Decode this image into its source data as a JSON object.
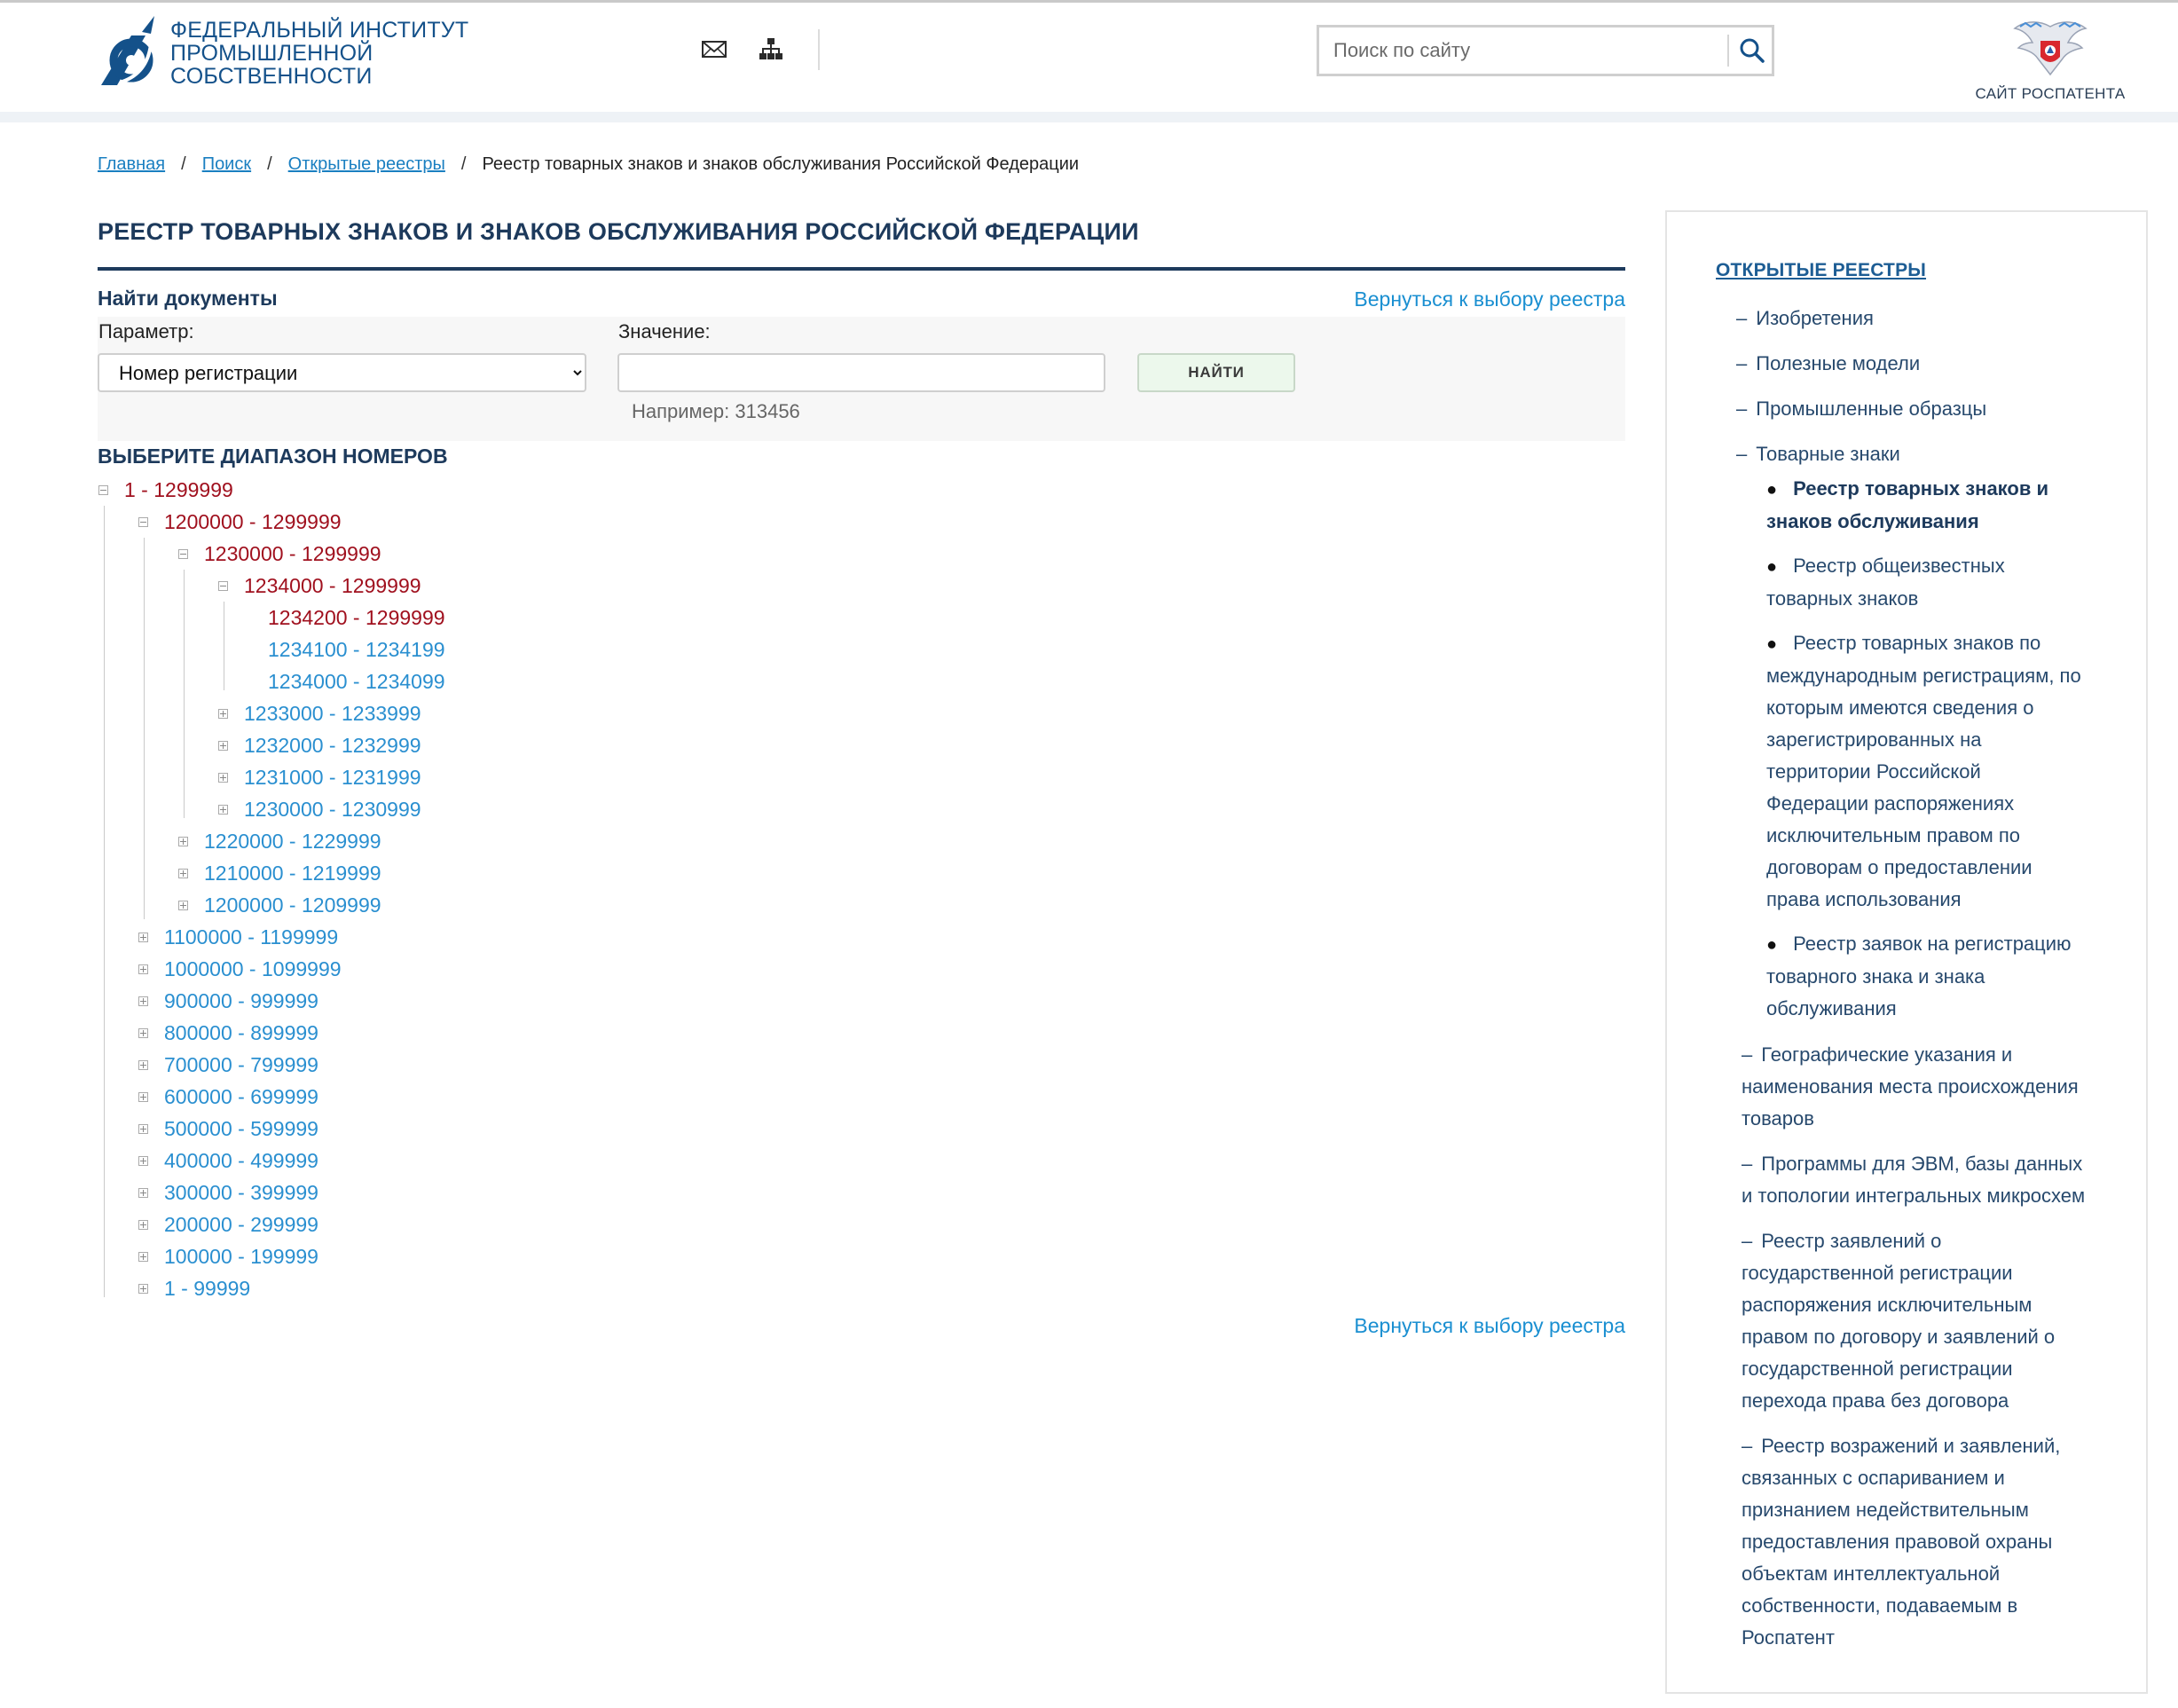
{
  "header": {
    "logo_lines": [
      "ФЕДЕРАЛЬНЫЙ ИНСТИТУТ",
      "ПРОМЫШЛЕННОЙ",
      "СОБСТВЕННОСТИ"
    ],
    "search_placeholder": "Поиск по сайту",
    "rospatent_label": "САЙТ РОСПАТЕНТА",
    "icons": [
      "mail-icon",
      "sitemap-icon",
      "search-icon",
      "rospatent-emblem"
    ],
    "colors": {
      "brand": "#14518a",
      "title": "#1d3a5c",
      "link": "#1a8fd1",
      "tree_open": "#a0101e"
    }
  },
  "breadcrumb": {
    "items": [
      "Главная",
      "Поиск",
      "Открытые реестры"
    ],
    "current": "Реестр товарных знаков и знаков обслуживания Российской Федерации"
  },
  "main": {
    "title": "РЕЕСТР ТОВАРНЫХ ЗНАКОВ И ЗНАКОВ ОБСЛУЖИВАНИЯ РОССИЙСКОЙ ФЕДЕРАЦИИ",
    "find_documents": "Найти документы",
    "back_link": "Вернуться к выбору реестра",
    "param_label": "Параметр:",
    "param_value": "Номер регистрации",
    "value_label": "Значение:",
    "value_input": "",
    "find_button": "НАЙТИ",
    "example": "Например: 313456",
    "range_title": "ВЫБЕРИТЕ ДИАПАЗОН НОМЕРОВ"
  },
  "tree": [
    {
      "label": "1 - 1299999",
      "level": 0,
      "state": "open"
    },
    {
      "label": "1200000 - 1299999",
      "level": 1,
      "state": "open"
    },
    {
      "label": "1230000 - 1299999",
      "level": 2,
      "state": "open"
    },
    {
      "label": "1234000 - 1299999",
      "level": 3,
      "state": "open"
    },
    {
      "label": "1234200 - 1299999",
      "level": 4,
      "state": "leaf-open"
    },
    {
      "label": "1234100 - 1234199",
      "level": 4,
      "state": "leaf"
    },
    {
      "label": "1234000 - 1234099",
      "level": 4,
      "state": "leaf"
    },
    {
      "label": "1233000 - 1233999",
      "level": 3,
      "state": "closed"
    },
    {
      "label": "1232000 - 1232999",
      "level": 3,
      "state": "closed"
    },
    {
      "label": "1231000 - 1231999",
      "level": 3,
      "state": "closed"
    },
    {
      "label": "1230000 - 1230999",
      "level": 3,
      "state": "closed"
    },
    {
      "label": "1220000 - 1229999",
      "level": 2,
      "state": "closed"
    },
    {
      "label": "1210000 - 1219999",
      "level": 2,
      "state": "closed"
    },
    {
      "label": "1200000 - 1209999",
      "level": 2,
      "state": "closed"
    },
    {
      "label": "1100000 - 1199999",
      "level": 1,
      "state": "closed"
    },
    {
      "label": "1000000 - 1099999",
      "level": 1,
      "state": "closed"
    },
    {
      "label": "900000 - 999999",
      "level": 1,
      "state": "closed"
    },
    {
      "label": "800000 - 899999",
      "level": 1,
      "state": "closed"
    },
    {
      "label": "700000 - 799999",
      "level": 1,
      "state": "closed"
    },
    {
      "label": "600000 - 699999",
      "level": 1,
      "state": "closed"
    },
    {
      "label": "500000 - 599999",
      "level": 1,
      "state": "closed"
    },
    {
      "label": "400000 - 499999",
      "level": 1,
      "state": "closed"
    },
    {
      "label": "300000 - 399999",
      "level": 1,
      "state": "closed"
    },
    {
      "label": "200000 - 299999",
      "level": 1,
      "state": "closed"
    },
    {
      "label": "100000 - 199999",
      "level": 1,
      "state": "closed"
    },
    {
      "label": "1 - 99999",
      "level": 1,
      "state": "closed"
    }
  ],
  "sidebar": {
    "heading": "ОТКРЫТЫЕ РЕЕСТРЫ",
    "items": [
      {
        "lines": [
          "Изобретения"
        ]
      },
      {
        "lines": [
          "Полезные модели"
        ]
      },
      {
        "lines": [
          "Промышленные образцы"
        ]
      },
      {
        "lines": [
          "Товарные знаки"
        ]
      },
      {
        "lines": [
          "Географические указания и",
          "наименования места происхождения",
          "товаров"
        ]
      },
      {
        "lines": [
          "Программы для ЭВМ, базы данных",
          "и топологии интегральных микросхем"
        ]
      },
      {
        "lines": [
          "Реестр заявлений о",
          "государственной регистрации",
          "распоряжения исключительным",
          "правом по договору и заявлений о",
          "государственной регистрации",
          "перехода права без договора"
        ]
      },
      {
        "lines": [
          "Реестр возражений и заявлений,",
          "связанных с оспариванием и",
          "признанием недействительным",
          "предоставления правовой охраны",
          "объектам интеллектуальной",
          "собственности, подаваемым в",
          "Роспатент"
        ]
      }
    ],
    "subitems": [
      {
        "lines": [
          "Реестр товарных знаков и",
          "знаков обслуживания"
        ],
        "active": true
      },
      {
        "lines": [
          "Реестр общеизвестных",
          "товарных знаков"
        ],
        "active": false
      },
      {
        "lines": [
          "Реестр товарных знаков по",
          "международным регистрациям, по",
          "которым имеются сведения о",
          "зарегистрированных на",
          "территории Российской",
          "Федерации распоряжениях",
          "исключительным правом по",
          "договорам о предоставлении",
          "права использования"
        ],
        "active": false
      },
      {
        "lines": [
          "Реестр заявок на регистрацию",
          "товарного знака и знака",
          "обслуживания"
        ],
        "active": false
      }
    ]
  }
}
